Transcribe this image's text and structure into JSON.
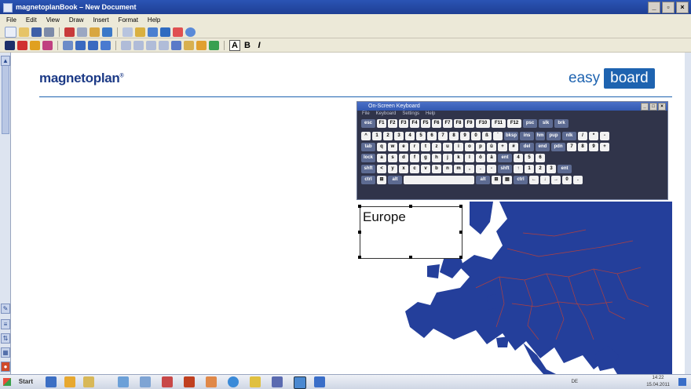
{
  "window": {
    "title": "magnetoplanBook – New Document"
  },
  "menu": [
    "File",
    "Edit",
    "View",
    "Draw",
    "Insert",
    "Format",
    "Help"
  ],
  "toolbar2": {
    "bold": "B",
    "italic": "I",
    "font_a": "A"
  },
  "brand": {
    "logo": "magnetoplan",
    "reg": "®",
    "easy": "easy",
    "board": "board"
  },
  "keyboard": {
    "title": "On-Screen Keyboard",
    "menu": [
      "File",
      "Keyboard",
      "Settings",
      "Help"
    ],
    "rows": [
      [
        "esc",
        "F1",
        "F2",
        "F3",
        "F4",
        "F5",
        "F6",
        "F7",
        "F8",
        "F9",
        "F10",
        "F11",
        "F12",
        "psc",
        "slk",
        "brk"
      ],
      [
        "^",
        "1",
        "2",
        "3",
        "4",
        "5",
        "6",
        "7",
        "8",
        "9",
        "0",
        "ß",
        "´",
        "bksp",
        "ins",
        "hm",
        "pup",
        "nlk",
        "/",
        "*",
        "-"
      ],
      [
        "tab",
        "q",
        "w",
        "e",
        "r",
        "t",
        "z",
        "u",
        "i",
        "o",
        "p",
        "ü",
        "+",
        "#",
        "del",
        "end",
        "pdn",
        "7",
        "8",
        "9",
        "+"
      ],
      [
        "lock",
        "a",
        "s",
        "d",
        "f",
        "g",
        "h",
        "j",
        "k",
        "l",
        "ö",
        "ä",
        "ent",
        "4",
        "5",
        "6"
      ],
      [
        "shft",
        "<",
        "y",
        "x",
        "c",
        "v",
        "b",
        "n",
        "m",
        ",",
        ".",
        "-",
        "shft",
        "↑",
        "1",
        "2",
        "3",
        "ent"
      ],
      [
        "ctrl",
        "⊞",
        "alt",
        "",
        "alt",
        "⊞",
        "▤",
        "ctrl",
        "←",
        "↓",
        "→",
        "0",
        "."
      ]
    ]
  },
  "textbox": {
    "text": "Europe"
  },
  "taskbar": {
    "start": "Start",
    "lang": "DE",
    "time": "14:22",
    "date": "15.04.2011"
  },
  "colors": {
    "titlebar": "#1e3f94",
    "brand_blue": "#1c3a86",
    "map_blue": "#243f9b"
  }
}
